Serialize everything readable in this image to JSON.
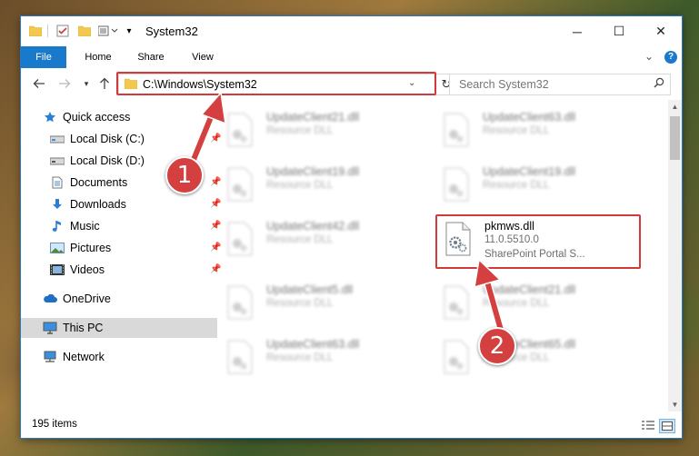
{
  "window": {
    "title": "System32",
    "minimize": "─",
    "maximize": "☐",
    "close": "✕"
  },
  "ribbon": {
    "tabs": [
      {
        "label": "File"
      },
      {
        "label": "Home"
      },
      {
        "label": "Share"
      },
      {
        "label": "View"
      }
    ],
    "help_icon": "?",
    "expand_icon": "⌄"
  },
  "address": {
    "path": "C:\\Windows\\System32",
    "search_placeholder": "Search System32"
  },
  "nav": {
    "items": [
      {
        "label": "Quick access"
      },
      {
        "label": "Local Disk (C:)"
      },
      {
        "label": "Local Disk (D:)"
      },
      {
        "label": "Documents"
      },
      {
        "label": "Downloads"
      },
      {
        "label": "Music"
      },
      {
        "label": "Pictures"
      },
      {
        "label": "Videos"
      },
      {
        "label": "OneDrive"
      },
      {
        "label": "This PC"
      },
      {
        "label": "Network"
      }
    ]
  },
  "files": [
    {
      "name": "UpdateClient21.dll",
      "type": "Resource DLL"
    },
    {
      "name": "UpdateClient63.dll",
      "type": "Resource DLL"
    },
    {
      "name": "UpdateClient19.dll",
      "type": "Resource DLL"
    },
    {
      "name": "UpdateClient19.dll",
      "type": "Resource DLL"
    },
    {
      "name": "UpdateClient42.dll",
      "type": "Resource DLL"
    },
    {
      "name": "pkmws.dll",
      "version": "11.0.5510.0",
      "description": "SharePoint Portal S..."
    },
    {
      "name": "UpdateClient5.dll",
      "type": "Resource DLL"
    },
    {
      "name": "UpdateClient21.dll",
      "type": "Resource DLL"
    },
    {
      "name": "UpdateClient63.dll",
      "type": "Resource DLL"
    },
    {
      "name": "UpdateClient65.dll",
      "type": "Resource DLL"
    }
  ],
  "status": {
    "item_count": "195 items"
  },
  "callouts": {
    "one": "1",
    "two": "2"
  },
  "colors": {
    "accent": "#1979ca",
    "highlight": "#d03a3a",
    "callout": "#d43f3f"
  }
}
